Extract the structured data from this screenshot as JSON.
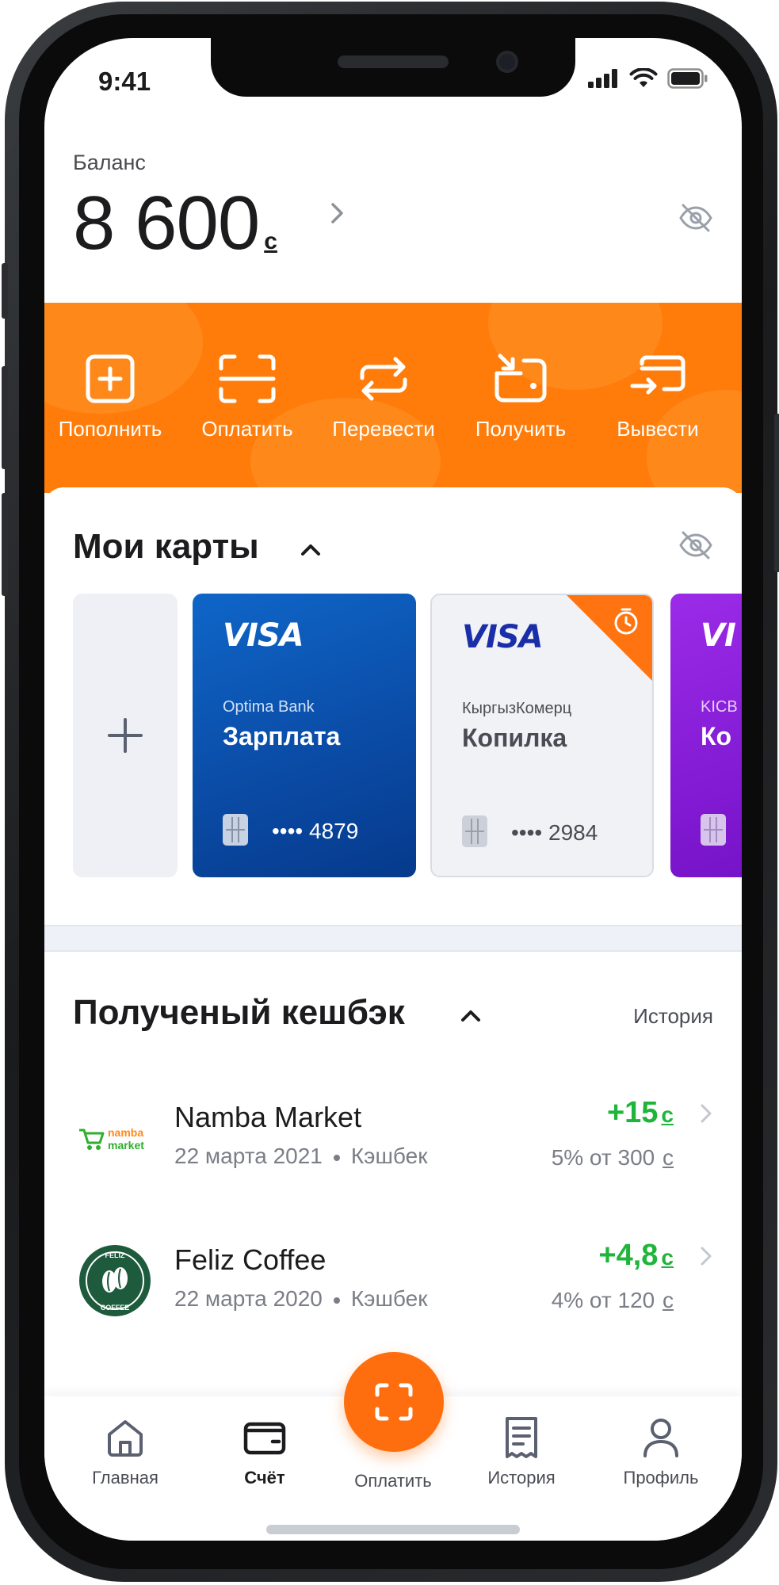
{
  "status": {
    "time": "9:41"
  },
  "balance": {
    "label": "Баланс",
    "amount": "8 600",
    "currency": "с"
  },
  "actions": [
    {
      "label": "Пополнить",
      "icon": "add-square-icon"
    },
    {
      "label": "Оплатить",
      "icon": "scan-icon"
    },
    {
      "label": "Перевести",
      "icon": "transfer-icon"
    },
    {
      "label": "Получить",
      "icon": "receive-icon"
    },
    {
      "label": "Вывести",
      "icon": "withdraw-icon"
    }
  ],
  "cards_section": {
    "title": "Мои карты",
    "cards": [
      {
        "brand": "VISA",
        "bank": "Optima Bank",
        "name": "Зарплата",
        "number": "•••• 4879"
      },
      {
        "brand": "VISA",
        "bank": "КыргызКомерц",
        "name": "Копилка",
        "number": "•••• 2984"
      },
      {
        "brand": "VI",
        "bank": "KICB",
        "name": "Ко"
      }
    ]
  },
  "cashback": {
    "title": "Полученый кешбэк",
    "history_link": "История",
    "items": [
      {
        "merchant": "Namba Market",
        "date": "22 марта 2021",
        "type": "Кэшбек",
        "amount": "+15",
        "currency": "с",
        "detail": "5% от 300",
        "logo_text": [
          "namba",
          "market"
        ]
      },
      {
        "merchant": "Feliz Coffee",
        "date": "22 марта 2020",
        "type": "Кэшбек",
        "amount": "+4,8",
        "currency": "с",
        "detail": "4% от 120",
        "logo_text": [
          "FELIZ",
          "COFFEE"
        ]
      }
    ]
  },
  "tabbar": {
    "items": [
      {
        "label": "Главная",
        "icon": "home-icon"
      },
      {
        "label": "Счёт",
        "icon": "wallet-icon",
        "active": true
      },
      {
        "label": "Оплатить",
        "icon": "scan-icon"
      },
      {
        "label": "История",
        "icon": "receipt-icon"
      },
      {
        "label": "Профиль",
        "icon": "user-icon"
      }
    ]
  },
  "colors": {
    "accent": "#ff7c0a",
    "positive": "#1fb53a",
    "card_blue": "#0a4aa4",
    "card_purple": "#7512c8"
  }
}
